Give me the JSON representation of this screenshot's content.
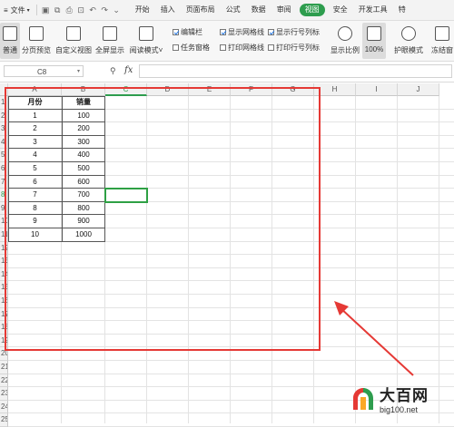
{
  "menubar": {
    "file_label": "文件",
    "tabs": [
      {
        "label": "开始"
      },
      {
        "label": "插入"
      },
      {
        "label": "页面布局"
      },
      {
        "label": "公式"
      },
      {
        "label": "数据"
      },
      {
        "label": "审阅"
      },
      {
        "label": "视图"
      },
      {
        "label": "安全"
      },
      {
        "label": "开发工具"
      },
      {
        "label": "特"
      }
    ],
    "active_tab": "视图"
  },
  "ribbon": {
    "normal_label": "普通",
    "page_break_label": "分页预览",
    "custom_view_label": "自定义视图",
    "fullscreen_label": "全屏显示",
    "reading_mode_label": "阅读模式",
    "formula_bar_label": "编辑栏",
    "task_pane_label": "任务窗格",
    "show_gridlines_label": "显示网格线",
    "print_gridlines_label": "打印网格线",
    "show_headers_label": "显示行号列标",
    "print_headers_label": "打印行号列标",
    "zoom_label": "显示比例",
    "zoom_100_label": "100%",
    "eye_mode_label": "护眼模式",
    "freeze_label": "冻结窗"
  },
  "formula_bar": {
    "name_box": "C8",
    "fx_label": "fx",
    "value": ""
  },
  "columns": [
    "A",
    "B",
    "C",
    "D",
    "E",
    "F",
    "G",
    "H",
    "I",
    "J"
  ],
  "rows": [
    "1",
    "2",
    "3",
    "4",
    "5",
    "6",
    "7",
    "8",
    "9",
    "10",
    "11",
    "12",
    "13",
    "14",
    "15",
    "16",
    "17",
    "18",
    "19",
    "20",
    "21",
    "22",
    "23",
    "24",
    "25"
  ],
  "table": {
    "headers": [
      "月份",
      "销量"
    ],
    "rows": [
      [
        "1",
        "100"
      ],
      [
        "2",
        "200"
      ],
      [
        "3",
        "300"
      ],
      [
        "4",
        "400"
      ],
      [
        "5",
        "500"
      ],
      [
        "6",
        "600"
      ],
      [
        "7",
        "700"
      ],
      [
        "8",
        "800"
      ],
      [
        "9",
        "900"
      ],
      [
        "10",
        "1000"
      ]
    ]
  },
  "selected_cell": "C8",
  "watermark": {
    "title": "大百网",
    "url": "big100.net"
  },
  "colors": {
    "accent": "#2e9d4e",
    "highlight_box": "#e53935",
    "selection": "#2ea044"
  }
}
